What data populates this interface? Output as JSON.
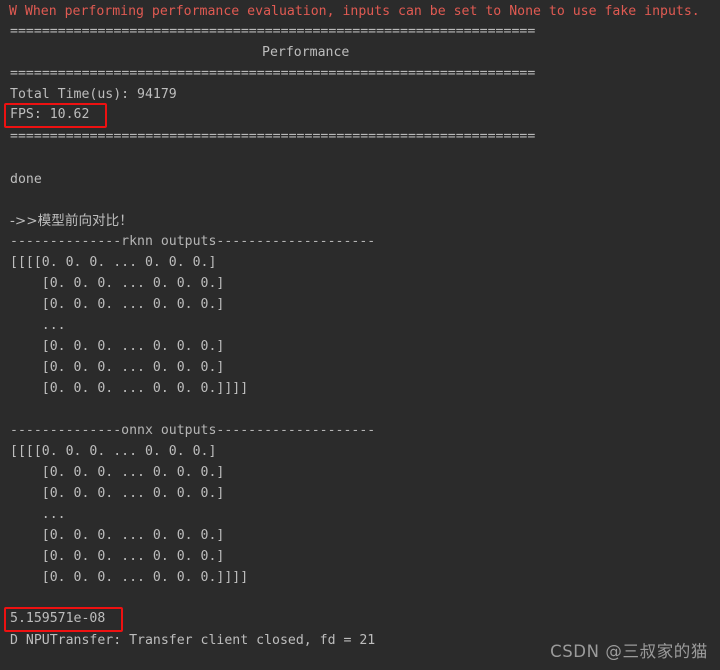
{
  "terminal": {
    "background_color": "#2b2b2b",
    "default_text_color": "#bdbdbd",
    "warning_text_color": "#e05a52",
    "highlight_box_color": "#ee1111",
    "lines": {
      "warning": "W When performing performance evaluation, inputs can be set to None to use fake inputs.",
      "separator_top": "==================================================================",
      "perf_heading": "Performance",
      "separator_mid": "==================================================================",
      "total_time": "Total Time(us): 94179",
      "fps": "FPS: 10.62",
      "separator_bottom": "==================================================================",
      "done": "done",
      "compare_heading": "->>模型前向对比！",
      "rknn_header": "--------------rknn outputs--------------------",
      "rknn_rows": [
        "[[[[0. 0. 0. ... 0. 0. 0.]",
        "    [0. 0. 0. ... 0. 0. 0.]",
        "    [0. 0. 0. ... 0. 0. 0.]",
        "    ...",
        "    [0. 0. 0. ... 0. 0. 0.]",
        "    [0. 0. 0. ... 0. 0. 0.]",
        "    [0. 0. 0. ... 0. 0. 0.]]]]"
      ],
      "onnx_header": "--------------onnx outputs--------------------",
      "onnx_rows": [
        "[[[[0. 0. 0. ... 0. 0. 0.]",
        "    [0. 0. 0. ... 0. 0. 0.]",
        "    [0. 0. 0. ... 0. 0. 0.]",
        "    ...",
        "    [0. 0. 0. ... 0. 0. 0.]",
        "    [0. 0. 0. ... 0. 0. 0.]",
        "    [0. 0. 0. ... 0. 0. 0.]]]]"
      ],
      "diff_value": "5.159571e-08",
      "npu_transfer": "D NPUTransfer: Transfer client closed, fd = 21"
    },
    "metrics": {
      "total_time_us": 94179,
      "fps": 10.62,
      "max_diff": "5.159571e-08",
      "fd": 21
    }
  },
  "watermark": {
    "text": "CSDN @三叔家的猫"
  }
}
